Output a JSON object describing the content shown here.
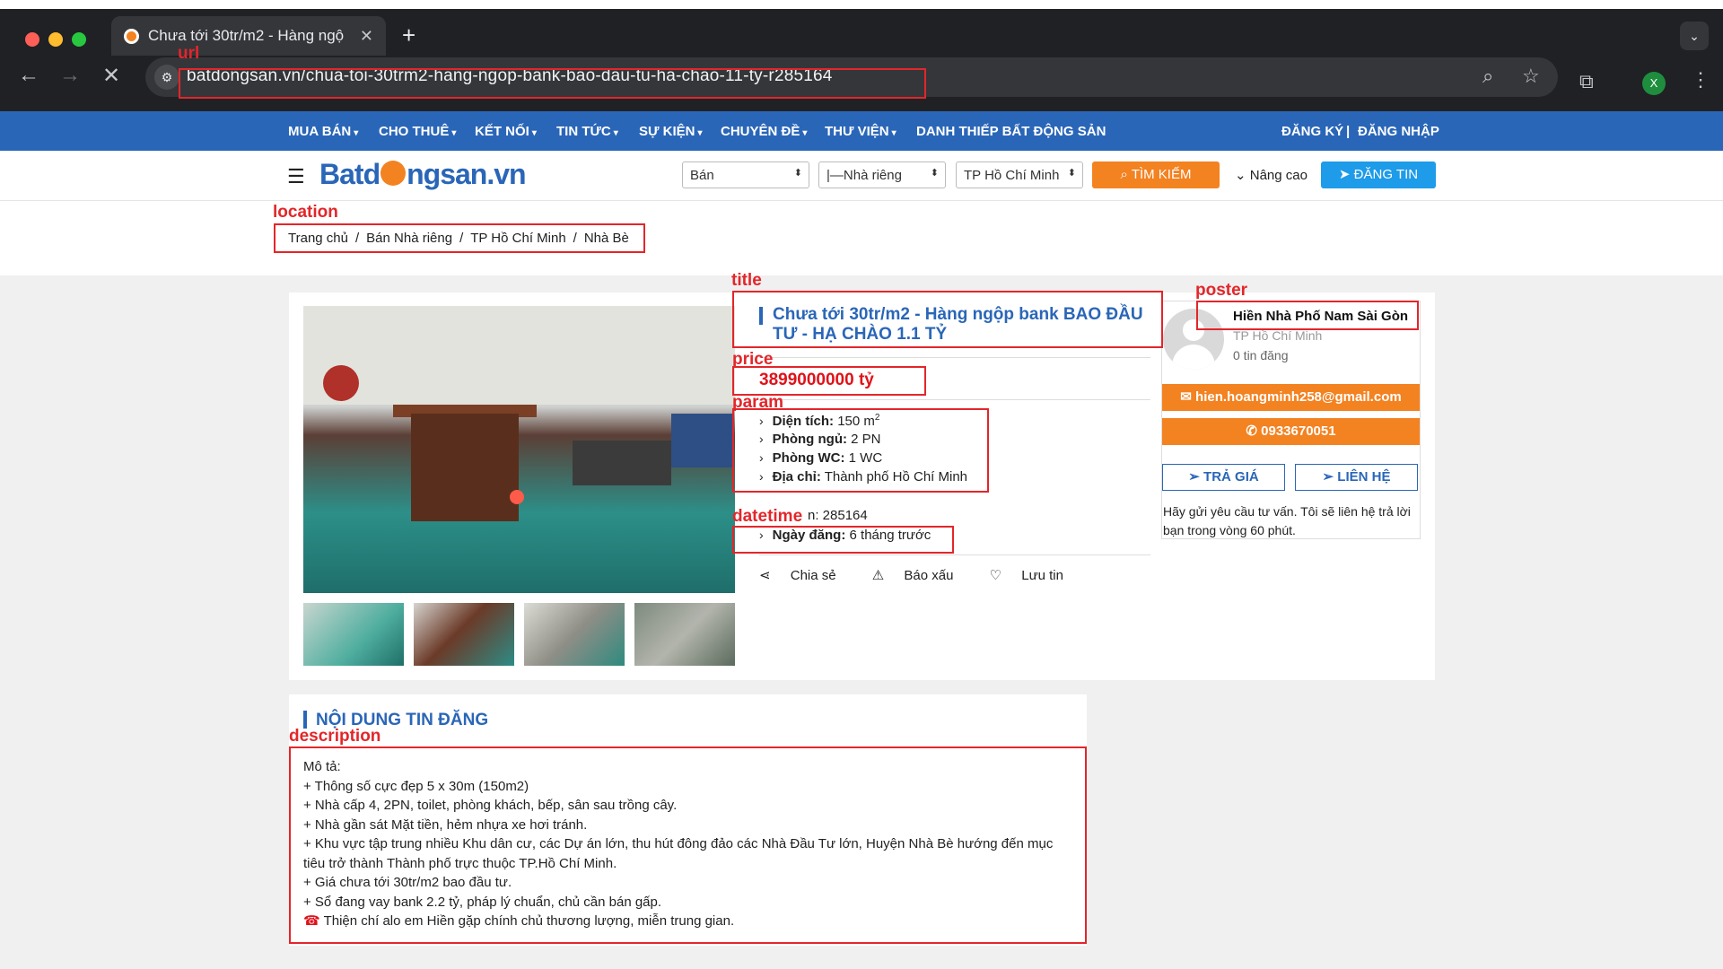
{
  "browser": {
    "tab_title": "Chưa tới 30tr/m2 - Hàng ngộ",
    "url": "batdongsan.vn/chua-toi-30trm2-hang-ngop-bank-bao-dau-tu-ha-chao-11-ty-r285164",
    "profile_initial": "X"
  },
  "top_menu": {
    "items": [
      {
        "label": "MUA BÁN"
      },
      {
        "label": "CHO THUÊ"
      },
      {
        "label": "KẾT NỐI"
      },
      {
        "label": "TIN TỨC"
      },
      {
        "label": "SỰ KIỆN"
      },
      {
        "label": "CHUYÊN ĐỀ"
      },
      {
        "label": "THƯ VIỆN"
      },
      {
        "label": "DANH THIẾP BẤT ĐỘNG SẢN"
      }
    ],
    "register": "ĐĂNG KÝ",
    "divider": "|",
    "login": "ĐĂNG NHẬP"
  },
  "header": {
    "logo_left": "Batd",
    "logo_right": "ngsan.vn",
    "select_type": "Bán",
    "select_category": "|—Nhà riêng",
    "select_city": "TP Hồ Chí Minh",
    "search_label": "TÌM KIẾM",
    "advanced_label": "Nâng cao",
    "post_label": "ĐĂNG TIN"
  },
  "breadcrumb": [
    "Trang chủ",
    "Bán Nhà riêng",
    "TP Hồ Chí Minh",
    "Nhà Bè"
  ],
  "listing": {
    "title": "Chưa tới 30tr/m2 - Hàng ngộp bank BAO ĐẦU TƯ - HẠ CHÀO 1.1 TỶ",
    "price": "3899000000 tỷ",
    "area_label": "Diện tích:",
    "area_value": "150 m",
    "area_unit_sup": "2",
    "bedrooms_label": "Phòng ngủ:",
    "bedrooms_value": "2 PN",
    "wc_label": "Phòng WC:",
    "wc_value": "1 WC",
    "address_label": "Địa chỉ:",
    "address_value": "Thành phố Hồ Chí Minh",
    "code_tail": "n: 285164",
    "date_label": "Ngày đăng:",
    "date_value": "6 tháng trước",
    "share_label": "Chia sẻ",
    "report_label": "Báo xấu",
    "save_label": "Lưu tin"
  },
  "poster": {
    "name": "Hiền Nhà Phố Nam Sài Gòn",
    "city": "TP Hồ Chí Minh",
    "post_count": "0 tin đăng",
    "email": "hien.hoangminh258@gmail.com",
    "phone": "0933670051",
    "offer_label": "TRẢ GIÁ",
    "contact_label": "LIÊN HỆ",
    "note": "Hãy gửi yêu cầu tư vấn. Tôi sẽ liên hệ trả lời bạn trong vòng 60 phút."
  },
  "description": {
    "heading": "NỘI DUNG TIN ĐĂNG",
    "lines": [
      "Mô tả:",
      "+ Thông số cực đẹp 5 x 30m (150m2)",
      "+ Nhà cấp 4, 2PN, toilet, phòng khách, bếp, sân sau trồng cây.",
      "+ Nhà gần sát Mặt tiền, hẻm nhựa xe hơi tránh.",
      "+ Khu vực tập trung nhiều Khu dân cư, các Dự án lớn, thu hút đông đảo các Nhà Đầu Tư lớn, Huyện Nhà Bè hướng đến mục tiêu trở thành Thành phố trực thuộc TP.Hồ Chí Minh.",
      "+ Giá chưa tới 30tr/m2 bao đầu tư.",
      "+ Sổ đang vay bank 2.2 tỷ, pháp lý chuẩn, chủ cần bán gấp.",
      "Thiện chí alo em Hiền gặp chính chủ thương lượng, miễn trung gian."
    ]
  },
  "annotations": {
    "url": "url",
    "location": "location",
    "title": "title",
    "price": "price",
    "param": "param",
    "datetime": "datetime",
    "poster": "poster",
    "description": "description"
  },
  "colors": {
    "annotation": "#e3262a",
    "brand_blue": "#2a66b8",
    "brand_orange": "#f38221",
    "post_button": "#1e9be9",
    "price_red": "#e0121a"
  }
}
